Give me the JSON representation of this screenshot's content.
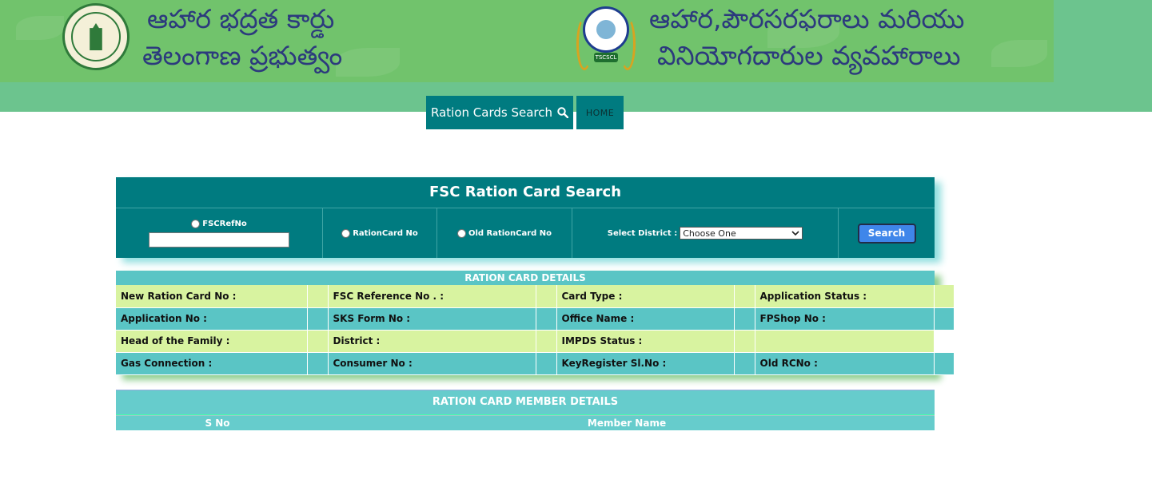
{
  "header": {
    "left_title_line1": "ఆహార భద్రత కార్డు",
    "left_title_line2": "తెలంగాణ ప్రభుత్వం",
    "right_title_line1": "ఆహార,పౌరసరఫరాలు మరియు",
    "right_title_line2": "వినియోగదారుల వ్యవహారాలు",
    "left_emblem_icon": "telangana-government-emblem",
    "right_emblem_icon": "tscscl-logo",
    "right_emblem_tag": "TSCSCL"
  },
  "nav": {
    "search_label": "Ration Cards Search",
    "search_icon": "magnifier-icon",
    "home_label": "HOME"
  },
  "search": {
    "title": "FSC Ration Card Search",
    "opt_fsc": "FSCRefNo",
    "opt_ration": "RationCard No",
    "opt_old": "Old RationCard No",
    "district_label": "Select District :",
    "district_selected": "Choose One",
    "button": "Search"
  },
  "details": {
    "title": "RATION CARD DETAILS",
    "rows": [
      [
        "New Ration Card No :",
        "FSC Reference No . :",
        "Card Type :",
        "Application Status :"
      ],
      [
        "Application No :",
        "SKS Form No :",
        "Office Name :",
        "FPShop No :"
      ],
      [
        "Head of the Family :",
        "District :",
        "IMPDS Status :",
        ""
      ],
      [
        "Gas Connection :",
        "Consumer No :",
        "KeyRegister Sl.No :",
        "Old RCNo :"
      ]
    ]
  },
  "members": {
    "title": "RATION CARD MEMBER DETAILS",
    "col_sno": "S No",
    "col_name": "Member Name"
  },
  "colors": {
    "teal": "#007b80",
    "banner_green": "#71c36c",
    "light_green_row": "#d8f3a0",
    "cyan_row": "#5ac5c5",
    "button_blue": "#3f86ea"
  }
}
